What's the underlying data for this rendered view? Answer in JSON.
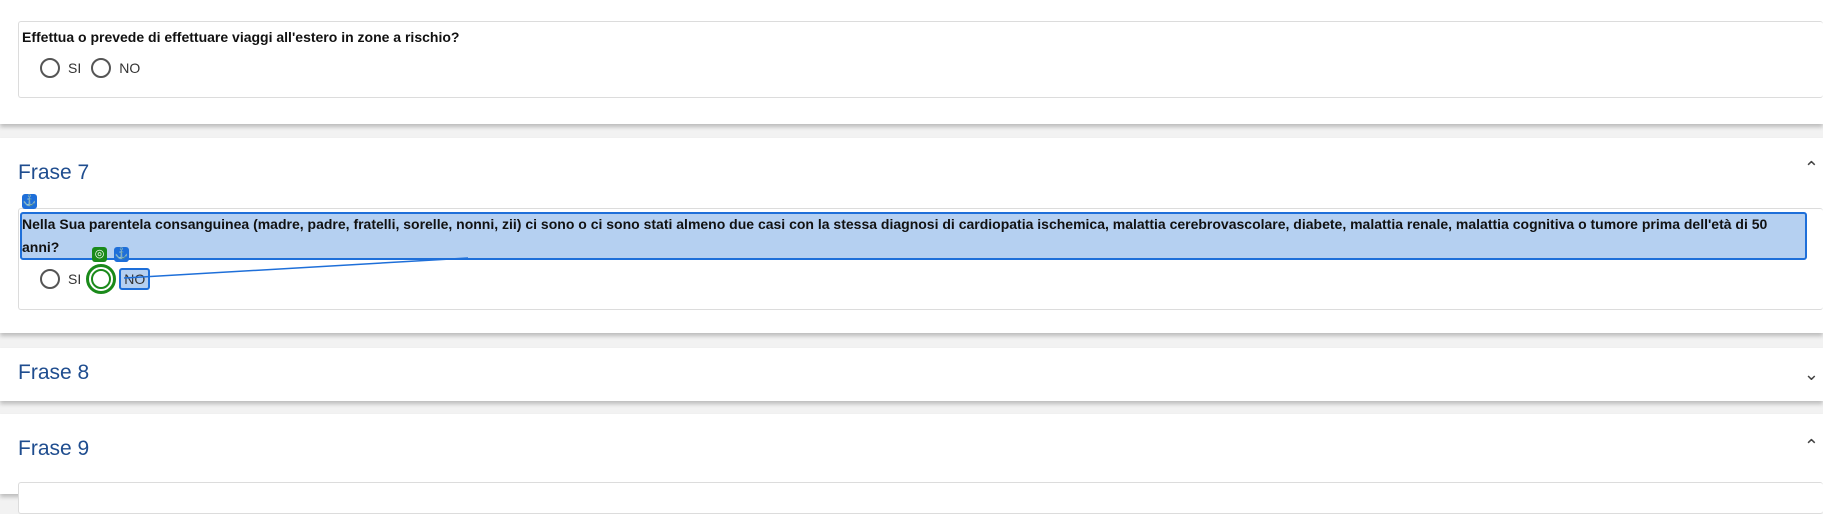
{
  "q_travel": {
    "text": "Effettua o prevede di effettuare viaggi all'estero in zone a rischio?",
    "options": [
      "SI",
      "NO"
    ]
  },
  "frase7": {
    "title": "Frase 7",
    "question": "Nella Sua parentela consanguinea (madre, padre, fratelli, sorelle, nonni, zii) ci sono o ci sono stati almeno due casi con la stessa diagnosi di cardiopatia ischemica, malattia cerebrovascolare, diabete, malattia renale, malattia cognitiva o tumore prima dell'età di 50 anni?",
    "options": [
      "SI",
      "NO"
    ]
  },
  "frase8": {
    "title": "Frase 8"
  },
  "frase9": {
    "title": "Frase 9"
  },
  "icons": {
    "anchor": "anchor-icon",
    "target": "target-icon",
    "chevron_up": "chevron-up-icon",
    "chevron_down": "chevron-down-icon"
  },
  "colors": {
    "title": "#1f4d8f",
    "highlight": "#78aae6",
    "highlight_border": "#1e6fd9",
    "target_tag": "#1a8a1a"
  }
}
